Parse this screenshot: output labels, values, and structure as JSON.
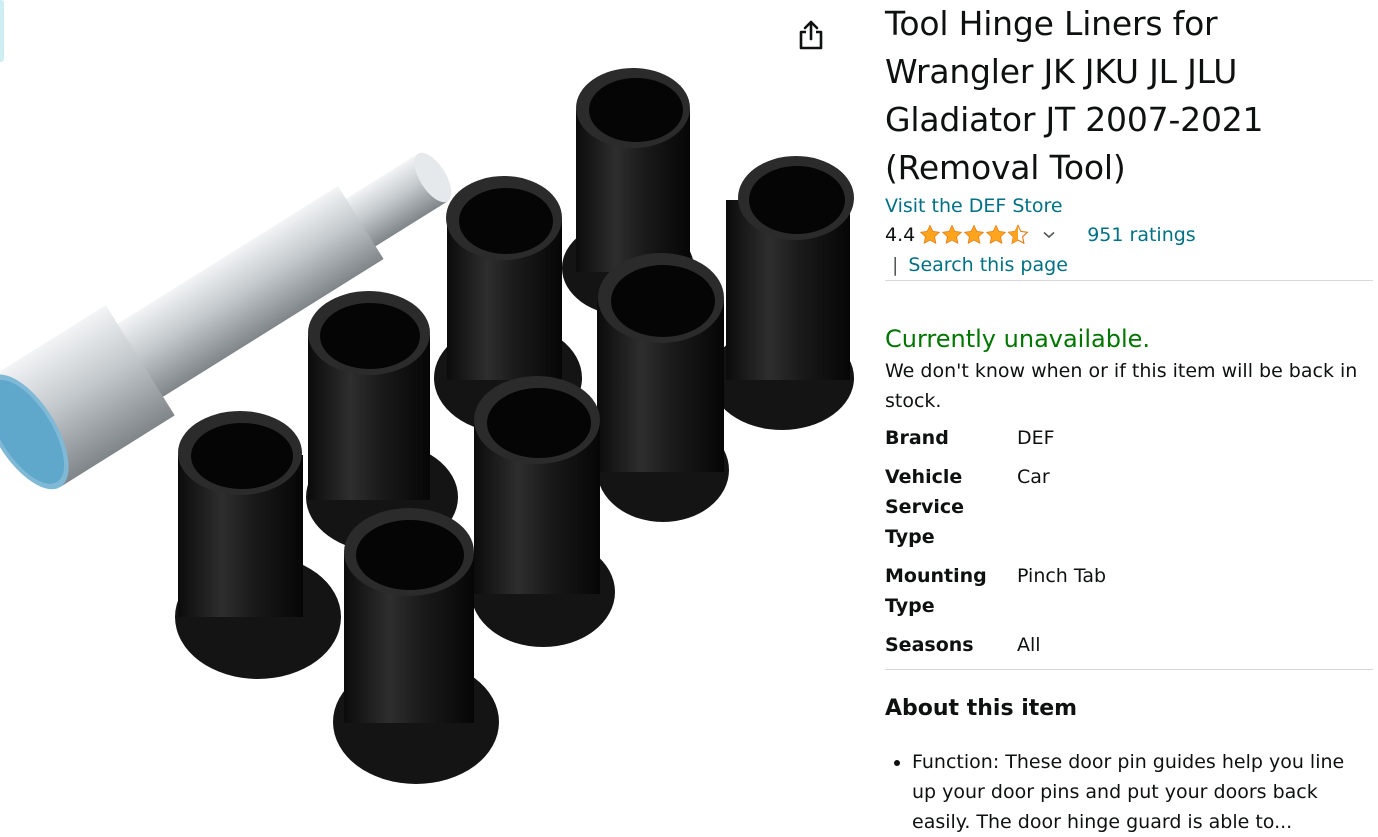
{
  "product": {
    "title": "Tool Hinge Liners for Wrangler JK JKU JL JLU Gladiator JT 2007-2021 (Removal Tool)",
    "store_link": "Visit the DEF Store",
    "rating_value": "4.4",
    "rating_stars": 4.4,
    "ratings_count": "951 ratings",
    "search_separator": "|",
    "search_link": "Search this page"
  },
  "icons": {
    "share": "share-icon",
    "stars": "star-icon",
    "chevron": "chevron-down-icon"
  },
  "availability": {
    "status": "Currently unavailable.",
    "note": "We don't know when or if this item will be back in stock."
  },
  "specs": [
    {
      "label": "Brand",
      "value": "DEF"
    },
    {
      "label": "Vehicle Service Type",
      "value": "Car"
    },
    {
      "label": "Mounting Type",
      "value": "Pinch Tab"
    },
    {
      "label": "Seasons",
      "value": "All"
    }
  ],
  "about": {
    "heading": "About this item",
    "bullets": [
      "Function: These door pin guides help you line up your door pins and put your doors back easily. The door hinge guard is able to..."
    ]
  },
  "colors": {
    "link": "#007185",
    "available_green": "#007600",
    "star": "#FFA41C",
    "text": "#0F1111"
  }
}
